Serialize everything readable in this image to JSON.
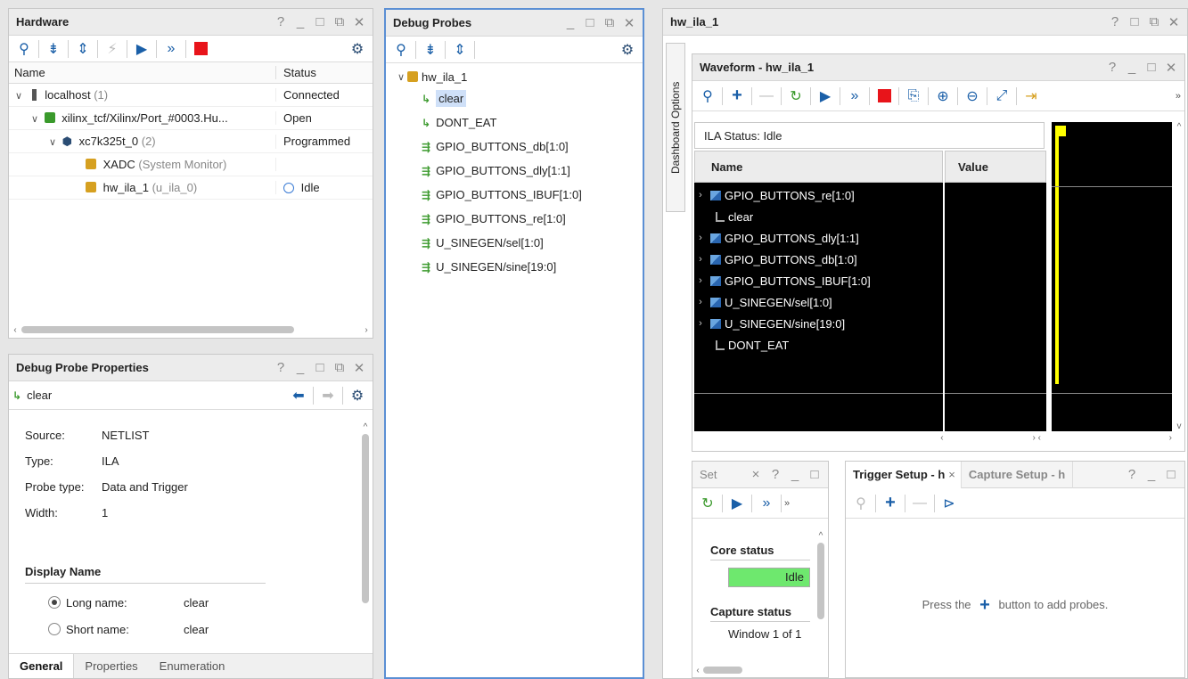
{
  "hardware": {
    "title": "Hardware",
    "columns": {
      "name": "Name",
      "status": "Status"
    },
    "rows": [
      {
        "name": "localhost",
        "suffix": "(1)",
        "status": "Connected"
      },
      {
        "name": "xilinx_tcf/Xilinx/Port_#0003.Hu...",
        "suffix": "",
        "status": "Open"
      },
      {
        "name": "xc7k325t_0",
        "suffix": "(2)",
        "status": "Programmed"
      },
      {
        "name": "XADC",
        "suffix": "(System Monitor)",
        "status": ""
      },
      {
        "name": "hw_ila_1",
        "suffix": "(u_ila_0)",
        "status": "Idle"
      }
    ]
  },
  "probe_props": {
    "title": "Debug Probe Properties",
    "selected": "clear",
    "fields": [
      {
        "label": "Source:",
        "value": "NETLIST"
      },
      {
        "label": "Type:",
        "value": "ILA"
      },
      {
        "label": "Probe type:",
        "value": "Data and Trigger"
      },
      {
        "label": "Width:",
        "value": "1"
      }
    ],
    "display_name_heading": "Display Name",
    "long_name_label": "Long name:",
    "long_name_value": "clear",
    "short_name_label": "Short name:",
    "short_name_value": "clear",
    "tabs": [
      "General",
      "Properties",
      "Enumeration"
    ]
  },
  "debug_probes": {
    "title": "Debug Probes",
    "root": "hw_ila_1",
    "items": [
      "clear",
      "DONT_EAT",
      "GPIO_BUTTONS_db[1:0]",
      "GPIO_BUTTONS_dly[1:1]",
      "GPIO_BUTTONS_IBUF[1:0]",
      "GPIO_BUTTONS_re[1:0]",
      "U_SINEGEN/sel[1:0]",
      "U_SINEGEN/sine[19:0]"
    ]
  },
  "hw_ila": {
    "title": "hw_ila_1",
    "side_tab": "Dashboard Options",
    "waveform_title": "Waveform - hw_ila_1",
    "ila_status": "ILA Status: Idle",
    "col_name": "Name",
    "col_value": "Value",
    "signals": [
      {
        "name": "GPIO_BUTTONS_re[1:0]",
        "bus": true
      },
      {
        "name": "clear",
        "bus": false
      },
      {
        "name": "GPIO_BUTTONS_dly[1:1]",
        "bus": true
      },
      {
        "name": "GPIO_BUTTONS_db[1:0]",
        "bus": true
      },
      {
        "name": "GPIO_BUTTONS_IBUF[1:0]",
        "bus": true
      },
      {
        "name": "U_SINEGEN/sel[1:0]",
        "bus": true
      },
      {
        "name": "U_SINEGEN/sine[19:0]",
        "bus": true
      },
      {
        "name": "DONT_EAT",
        "bus": false
      }
    ],
    "settings_tab": "Set",
    "core_status_label": "Core status",
    "core_status_value": "Idle",
    "capture_status_label": "Capture status",
    "capture_status_value": "Window 1 of 1",
    "trigger_tab": "Trigger Setup - h",
    "capture_tab": "Capture Setup - h",
    "hint_prefix": "Press the",
    "hint_suffix": "button to add probes."
  },
  "colors": {
    "accent": "#1a5fa8",
    "stop": "#e8141a",
    "idle_green": "#6ee86e",
    "focus_border": "#5b8fd4",
    "marker": "#ffff00"
  }
}
